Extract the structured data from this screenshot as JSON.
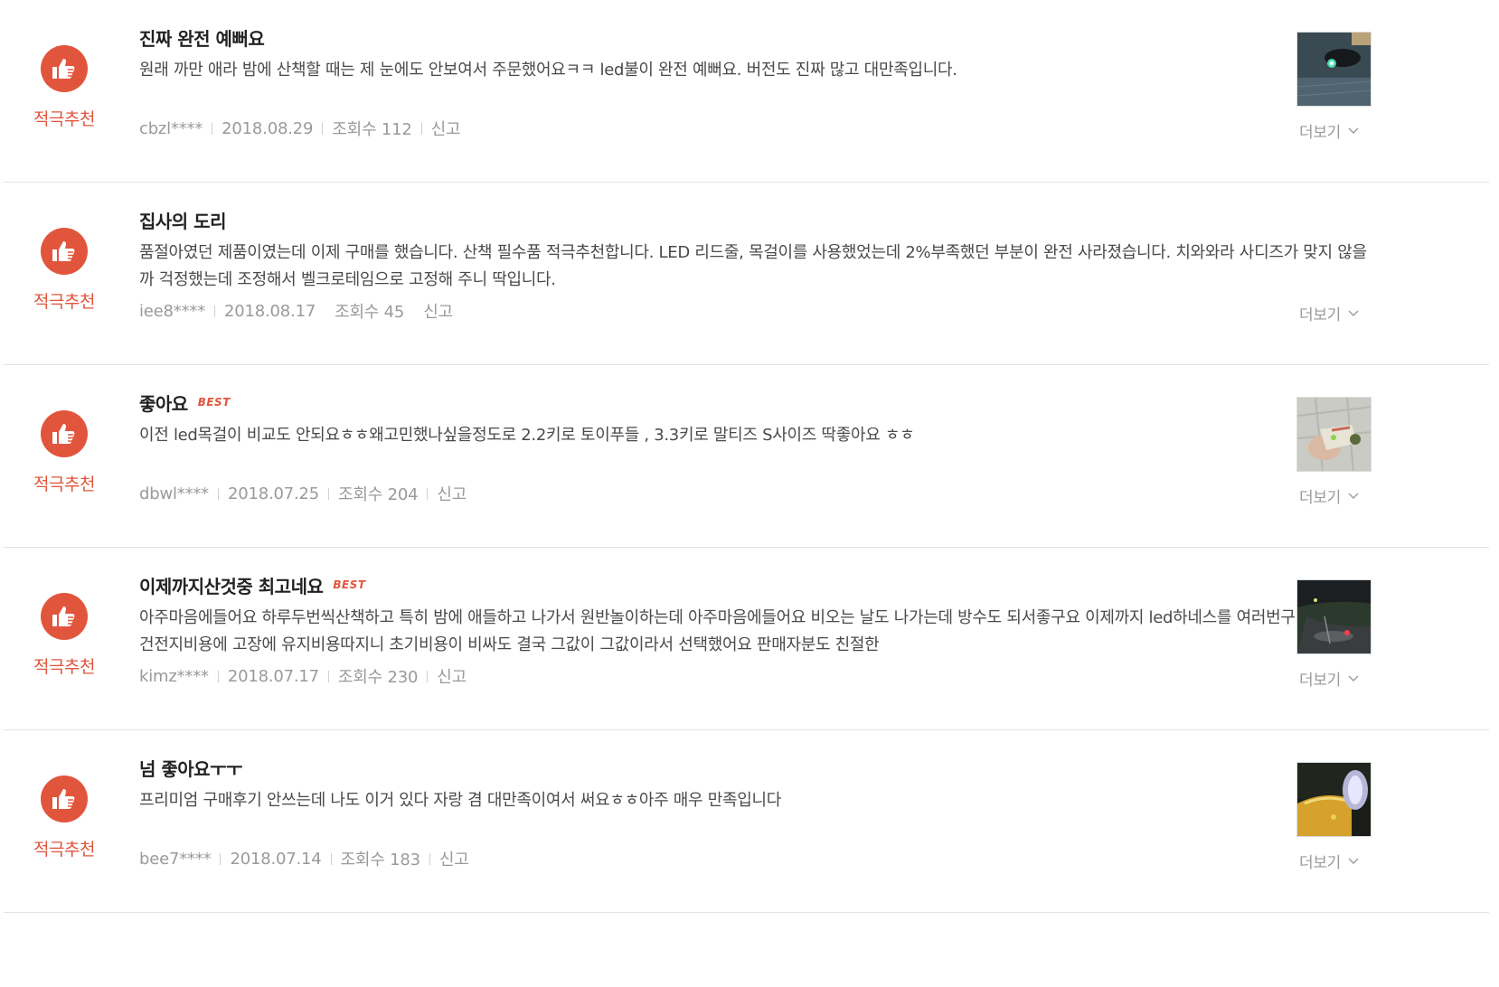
{
  "reviews": [
    {
      "badge": "적극추천",
      "title": "진짜 완전 예뻐요",
      "best": false,
      "body": "원래 까만 애라 밤에 산책할 때는 제 눈에도 안보여서 주문했어요ㅋㅋ led불이 완전 예뻐요. 버전도 진짜 많고 대만족입니다.",
      "user": "cbzl****",
      "date": "2018.08.29",
      "views": "조회수 112",
      "report": "신고",
      "has_photo": true,
      "more": "더보기"
    },
    {
      "badge": "적극추천",
      "title": "집사의 도리",
      "best": false,
      "body": "품절아였던 제품이였는데 이제 구매를 했습니다. 산책 필수품 적극추천합니다. LED 리드줄, 목걸이를 사용했었는데 2%부족했던 부분이 완전 사라졌습니다. 치와와라 사디즈가 맞지 않을까 걱정했는데 조정해서 벨크로테임으로 고정해 주니 딱입니다.",
      "user": "iee8****",
      "date": "2018.08.17",
      "views": "조회수 45",
      "report": "신고",
      "has_photo": false,
      "more": "더보기"
    },
    {
      "badge": "적극추천",
      "title": "좋아요",
      "best": true,
      "best_label": "BEST",
      "body": "이전 led목걸이 비교도 안되요ㅎㅎ왜고민했나싶을정도로 2.2키로 토이푸들 , 3.3키로 말티즈 S사이즈 딱좋아요 ㅎㅎ",
      "user": "dbwl****",
      "date": "2018.07.25",
      "views": "조회수 204",
      "report": "신고",
      "has_photo": true,
      "more": "더보기"
    },
    {
      "badge": "적극추천",
      "title": "이제까지산것중 최고네요",
      "best": true,
      "best_label": "BEST",
      "body": "아주마음에들어요 하루두번씩산책하고 특히 밤에 애들하고 나가서 원반놀이하는데 아주마음에들어요 비오는 날도 나가는데 방수도 되서좋구요 이제까지 led하네스를 여러번구매했는데 건전지비용에 고장에 유지비용따지니 초기비용이 비싸도 결국 그값이 그값이라서 선택했어요 판매자분도 친절한",
      "user": "kimz****",
      "date": "2018.07.17",
      "views": "조회수 230",
      "report": "신고",
      "has_photo": true,
      "more": "더보기"
    },
    {
      "badge": "적극추천",
      "title": "넘 좋아요ㅜㅜ",
      "best": false,
      "body": "프리미엄 구매후기 안쓰는데 나도 이거 있다 자랑 겸 대만족이여서 써요ㅎㅎ아주 매우 만족입니다",
      "user": "bee7****",
      "date": "2018.07.14",
      "views": "조회수 183",
      "report": "신고",
      "has_photo": true,
      "more": "더보기"
    }
  ],
  "colors": {
    "accent": "#e2553d",
    "text": "#4a4a4a",
    "meta": "#9a9a9a",
    "divider": "#e4e4e4"
  },
  "icons": {
    "badge": "thumbs-up-icon",
    "more": "chevron-down-icon"
  }
}
